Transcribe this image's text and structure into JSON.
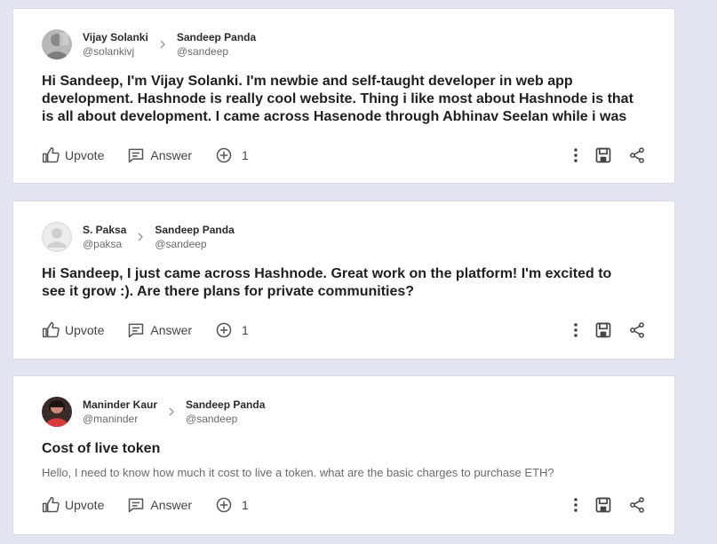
{
  "posts": [
    {
      "author_name": "Vijay Solanki",
      "author_handle": "@solankivj",
      "target_name": "Sandeep Panda",
      "target_handle": "@sandeep",
      "title_lines": [
        "Hi Sandeep, I'm Vijay Solanki. I'm newbie and self-taught developer in web app",
        "development. Hashnode is really cool website. Thing i like most about Hashnode is that",
        "is all about development. I came across Hasenode through Abhinav Seelan while i was"
      ],
      "description": "",
      "upvote_label": "Upvote",
      "answer_label": "Answer",
      "answer_count": "1"
    },
    {
      "author_name": "S. Paksa",
      "author_handle": "@paksa",
      "target_name": "Sandeep Panda",
      "target_handle": "@sandeep",
      "title_lines": [
        "Hi Sandeep, I just came across Hashnode. Great work on the platform! I'm excited to",
        "see it grow :). Are there plans for private communities?"
      ],
      "description": "",
      "upvote_label": "Upvote",
      "answer_label": "Answer",
      "answer_count": "1"
    },
    {
      "author_name": "Maninder Kaur",
      "author_handle": "@maninder",
      "target_name": "Sandeep Panda",
      "target_handle": "@sandeep",
      "title_lines": [
        "Cost of live token"
      ],
      "description": "Hello, I need to know how much it cost to live a token. what are the basic charges to purchase ETH?",
      "upvote_label": "Upvote",
      "answer_label": "Answer",
      "answer_count": "1"
    }
  ],
  "icons": {
    "separator": "chevron-right-icon",
    "upvote": "thumbs-up-icon",
    "answer": "answer-icon",
    "add_answer": "plus-circle-icon",
    "more": "more-vertical-icon",
    "bookmark": "bookmark-icon",
    "share": "share-icon"
  },
  "colors": {
    "page_background": "#e3e4f2",
    "card_background": "#ffffff"
  }
}
